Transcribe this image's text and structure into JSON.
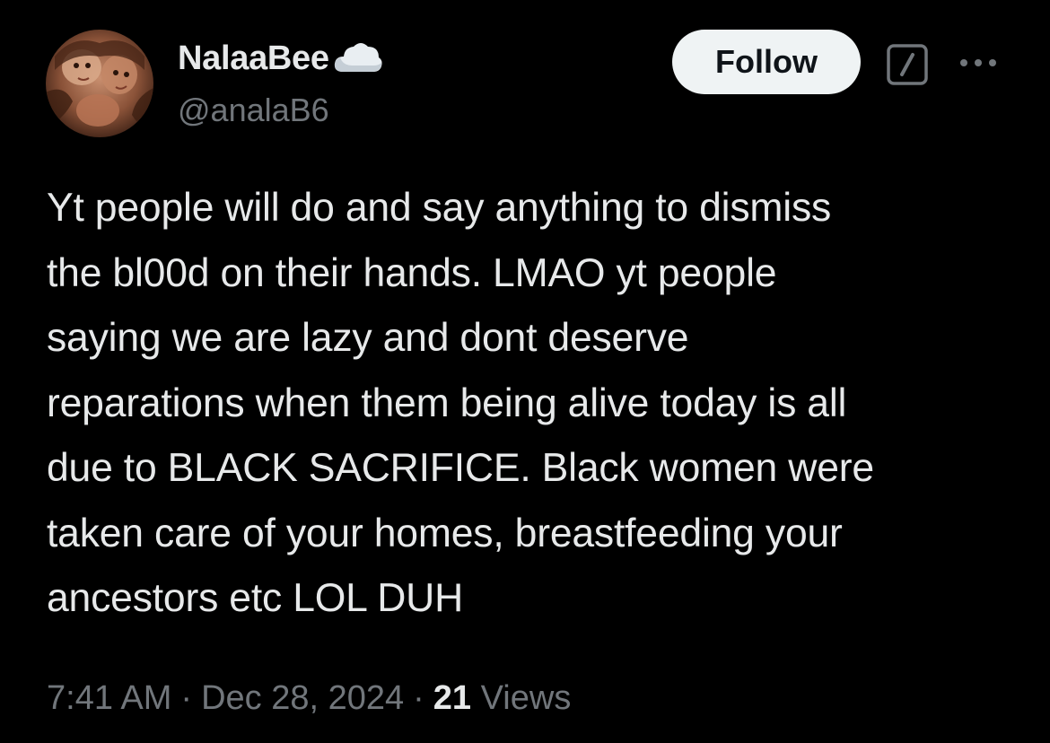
{
  "author": {
    "display_name": "NalaaBee",
    "handle": "@analaB6",
    "name_emoji": "cloud-icon",
    "avatar": "avatar"
  },
  "actions": {
    "follow_label": "Follow",
    "grok_icon": "grok-icon",
    "more_icon": "more-icon"
  },
  "tweet": {
    "lines": [
      "Yt people will do and say anything to dismiss",
      "the bl00d on their hands. LMAO yt people",
      "saying we are lazy and dont deserve",
      "reparations when them being alive today is all",
      "due to BLACK SACRIFICE. Black women were",
      "taken care of your homes, breastfeeding your",
      "ancestors etc LOL DUH"
    ]
  },
  "meta": {
    "time": "7:41 AM",
    "separator": "·",
    "date": "Dec 28, 2024",
    "views_count": "21",
    "views_label": "Views"
  },
  "colors": {
    "background": "#000000",
    "primary_text": "#e7e9ea",
    "secondary_text": "#71767b",
    "follow_bg": "#eff3f4",
    "follow_text": "#0f1419"
  }
}
